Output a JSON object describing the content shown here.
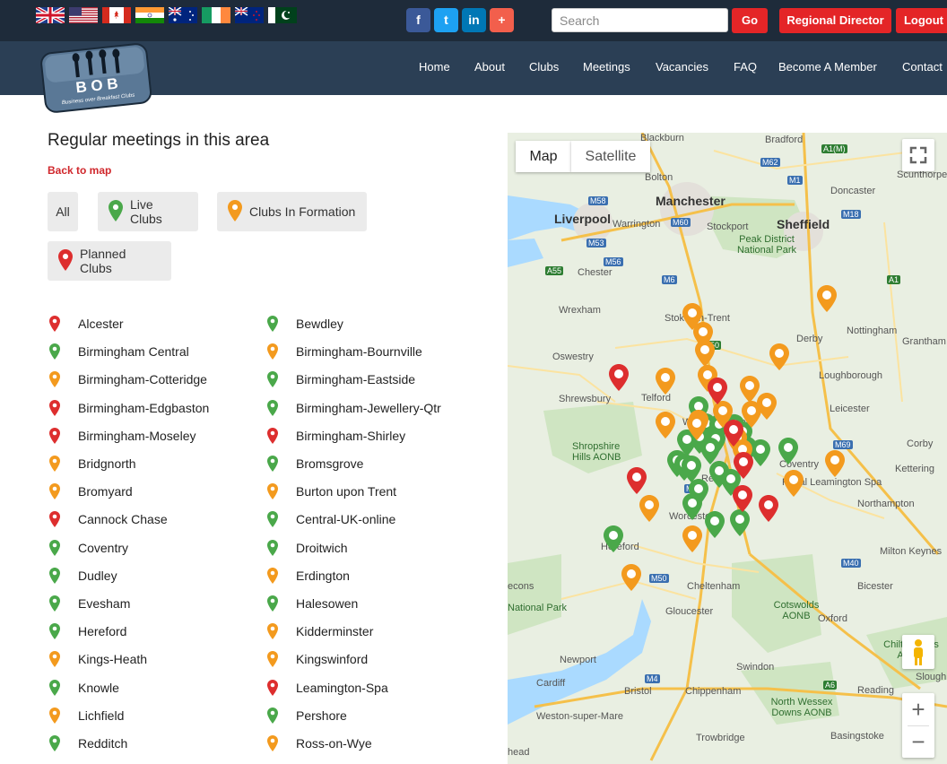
{
  "header": {
    "flags": [
      "uk-flag",
      "usa-flag",
      "canada-flag",
      "india-flag",
      "australia-flag",
      "ireland-flag",
      "new-zealand-flag",
      "pakistan-flag"
    ],
    "social": [
      {
        "icon": "facebook-icon",
        "glyph": "f",
        "color": "#3b5998"
      },
      {
        "icon": "twitter-icon",
        "glyph": "t",
        "color": "#1da1f2"
      },
      {
        "icon": "linkedin-icon",
        "glyph": "in",
        "color": "#0077b5"
      },
      {
        "icon": "plus-icon",
        "glyph": "+",
        "color": "#f25f4c"
      }
    ],
    "search_placeholder": "Search",
    "go_label": "Go",
    "regional_director_label": "Regional Director",
    "logout_label": "Logout"
  },
  "logo": {
    "text": "B O B",
    "tagline": "Business over Breakfast Clubs"
  },
  "nav": [
    "Home",
    "About",
    "Clubs",
    "Meetings",
    "Vacancies",
    "FAQ",
    "Become A Member",
    "Contact"
  ],
  "main": {
    "title": "Regular meetings in this area",
    "back_link": "Back to map",
    "filters": {
      "all": "All",
      "live": "Live Clubs",
      "formation": "Clubs In Formation",
      "planned": "Planned Clubs"
    }
  },
  "colors": {
    "live": "#4aa84a",
    "formation": "#f39a1e",
    "planned": "#dd2e2e"
  },
  "clubs_left": [
    {
      "name": "Alcester",
      "status": "planned"
    },
    {
      "name": "Birmingham Central",
      "status": "live"
    },
    {
      "name": "Birmingham-Cotteridge",
      "status": "formation"
    },
    {
      "name": "Birmingham-Edgbaston",
      "status": "planned"
    },
    {
      "name": "Birmingham-Moseley",
      "status": "planned"
    },
    {
      "name": "Bridgnorth",
      "status": "formation"
    },
    {
      "name": "Bromyard",
      "status": "formation"
    },
    {
      "name": "Cannock Chase",
      "status": "planned"
    },
    {
      "name": "Coventry",
      "status": "live"
    },
    {
      "name": "Dudley",
      "status": "live"
    },
    {
      "name": "Evesham",
      "status": "live"
    },
    {
      "name": "Hereford",
      "status": "live"
    },
    {
      "name": "Kings-Heath",
      "status": "formation"
    },
    {
      "name": "Knowle",
      "status": "live"
    },
    {
      "name": "Lichfield",
      "status": "formation"
    },
    {
      "name": "Redditch",
      "status": "live"
    }
  ],
  "clubs_right": [
    {
      "name": "Bewdley",
      "status": "live"
    },
    {
      "name": "Birmingham-Bournville",
      "status": "formation"
    },
    {
      "name": "Birmingham-Eastside",
      "status": "live"
    },
    {
      "name": "Birmingham-Jewellery-Qtr",
      "status": "live"
    },
    {
      "name": "Birmingham-Shirley",
      "status": "planned"
    },
    {
      "name": "Bromsgrove",
      "status": "live"
    },
    {
      "name": "Burton upon Trent",
      "status": "formation"
    },
    {
      "name": "Central-UK-online",
      "status": "live"
    },
    {
      "name": "Droitwich",
      "status": "live"
    },
    {
      "name": "Erdington",
      "status": "formation"
    },
    {
      "name": "Halesowen",
      "status": "live"
    },
    {
      "name": "Kidderminster",
      "status": "formation"
    },
    {
      "name": "Kingswinford",
      "status": "formation"
    },
    {
      "name": "Leamington-Spa",
      "status": "planned"
    },
    {
      "name": "Pershore",
      "status": "live"
    },
    {
      "name": "Ross-on-Wye",
      "status": "formation"
    }
  ],
  "map": {
    "tab_map": "Map",
    "tab_satellite": "Satellite",
    "zoom_in": "+",
    "zoom_out": "−",
    "places_major": [
      "Manchester",
      "Liverpool",
      "Sheffield"
    ],
    "places": [
      "Blackburn",
      "Bradford",
      "Bolton",
      "Doncaster",
      "Scunthorpe",
      "Warrington",
      "Stockport",
      "Chester",
      "Wrexham",
      "Stoke-on-Trent",
      "Derby",
      "Nottingham",
      "Grantham",
      "Oswestry",
      "Shrewsbury",
      "Telford",
      "Loughborough",
      "Wolverhampton",
      "Leicester",
      "Corby",
      "Coventry",
      "Kettering",
      "Royal Leamington Spa",
      "Redditch",
      "Worcester",
      "Northampton",
      "Hereford",
      "Milton Keynes",
      "Cheltenham",
      "Gloucester",
      "Bicester",
      "Oxford",
      "Newport",
      "Swindon",
      "Cardiff",
      "Bristol",
      "Chippenham",
      "Reading",
      "Weston-super-Mare",
      "Trowbridge",
      "Basingstoke",
      "Slough",
      "Chiltern Hills AONB",
      "Peak District National Park",
      "Shropshire Hills AONB",
      "Cotswolds AONB",
      "North Wessex Downs AONB",
      "National Park",
      "econs",
      "head"
    ],
    "roads": [
      "A1(M)",
      "M62",
      "M1",
      "M18",
      "M58",
      "M60",
      "M53",
      "M56",
      "A55",
      "M6",
      "A50",
      "A1",
      "M69",
      "M5",
      "M40",
      "M4",
      "M50",
      "A6"
    ],
    "marker_counts": {
      "live": 20,
      "formation": 22,
      "planned": 7
    }
  }
}
